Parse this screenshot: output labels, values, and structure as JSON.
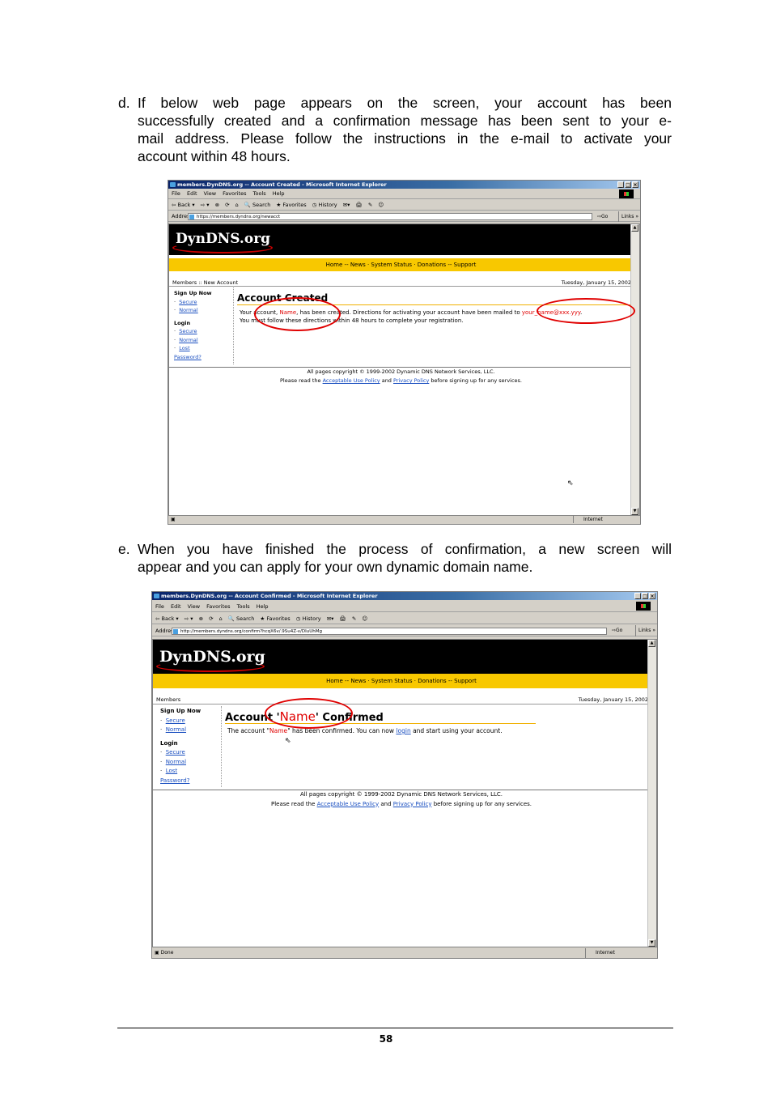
{
  "step_d": {
    "label": "d.",
    "lines": [
      "If below web page appears on the screen, your account has been",
      "successfully created and a confirmation message has been sent to your e-",
      "mail address. Please follow the instructions in the e-mail to activate your",
      "account within 48 hours."
    ]
  },
  "step_e": {
    "label": "e.",
    "lines": [
      "When you have finished the process of confirmation, a new screen will",
      "appear and you can apply for your own dynamic domain name."
    ]
  },
  "menu_items": [
    "File",
    "Edit",
    "View",
    "Favorites",
    "Tools",
    "Help"
  ],
  "toolbar_items": [
    "⇦ Back ▾",
    "⇨ ▾",
    "⊗",
    "⟳",
    "⌂",
    "🔍 Search",
    "★ Favorites",
    "◷ History",
    "✉▾",
    "🖨",
    "✎",
    "☺"
  ],
  "browser1": {
    "title": "members.DynDNS.org -- Account Created - Microsoft Internet Explorer",
    "address_label": "Address",
    "url": "https://members.dyndns.org/newacct",
    "go": "⇨Go",
    "links": "Links »",
    "logo": "DynDNS.org",
    "nav": "Home -- News · System Status · Donations -- Support",
    "crumb": "Members :: New Account",
    "date": "Tuesday, January 15, 2002",
    "signup_heading": "Sign Up Now",
    "login_heading": "Login",
    "secure": "Secure",
    "normal": "Normal",
    "lost": "Lost",
    "password": "Password?",
    "content_title": "Account Created",
    "text_l1_a": "Your account, ",
    "text_l1_name": "Name",
    "text_l1_b": ", has been created. Directions for activating your account have been mailed to ",
    "text_l1_email": "your_name@xxx.yyy",
    "text_l1_c": ".",
    "text_l2": "You must follow these directions within 48 hours to complete your registration.",
    "footer_l1": "All pages copyright © 1999-2002 Dynamic DNS Network Services, LLC.",
    "footer_l2_a": "Please read the ",
    "footer_aup": "Acceptable Use Policy",
    "footer_and": " and ",
    "footer_pp": "Privacy Policy",
    "footer_l2_b": " before signing up for any services.",
    "status": "",
    "zone": "Internet"
  },
  "browser2": {
    "title": "members.DynDNS.org -- Account Confirmed - Microsoft Internet Explorer",
    "address_label": "Address",
    "url": "http://members.dyndns.org/confirm?hcqX6v/.9Su4Z-v/DIuUhMg",
    "go": "⇨Go",
    "links": "Links »",
    "logo": "DynDNS.org",
    "nav": "Home -- News · System Status · Donations -- Support",
    "crumb": "Members",
    "date": "Tuesday, January 15, 2002",
    "signup_heading": "Sign Up Now",
    "login_heading": "Login",
    "secure": "Secure",
    "normal": "Normal",
    "lost": "Lost",
    "password": "Password?",
    "title_a": "Account '",
    "title_name": "Name",
    "title_b": "' Confirmed",
    "text_a": "The account \"",
    "text_name": "Name",
    "text_b": "\" has been confirmed. You can now ",
    "text_login": "login",
    "text_c": " and start using your account.",
    "footer_l1": "All pages copyright © 1999-2002 Dynamic DNS Network Services, LLC.",
    "footer_l2_a": "Please read the ",
    "footer_aup": "Acceptable Use Policy",
    "footer_and": " and ",
    "footer_pp": "Privacy Policy",
    "footer_l2_b": " before signing up for any services.",
    "status": "Done",
    "zone": "Internet"
  },
  "page_number": "58",
  "colors": {
    "nav_yellow": "#f8c800",
    "highlight_red": "#e00000",
    "link_blue": "#1a4fc0"
  }
}
